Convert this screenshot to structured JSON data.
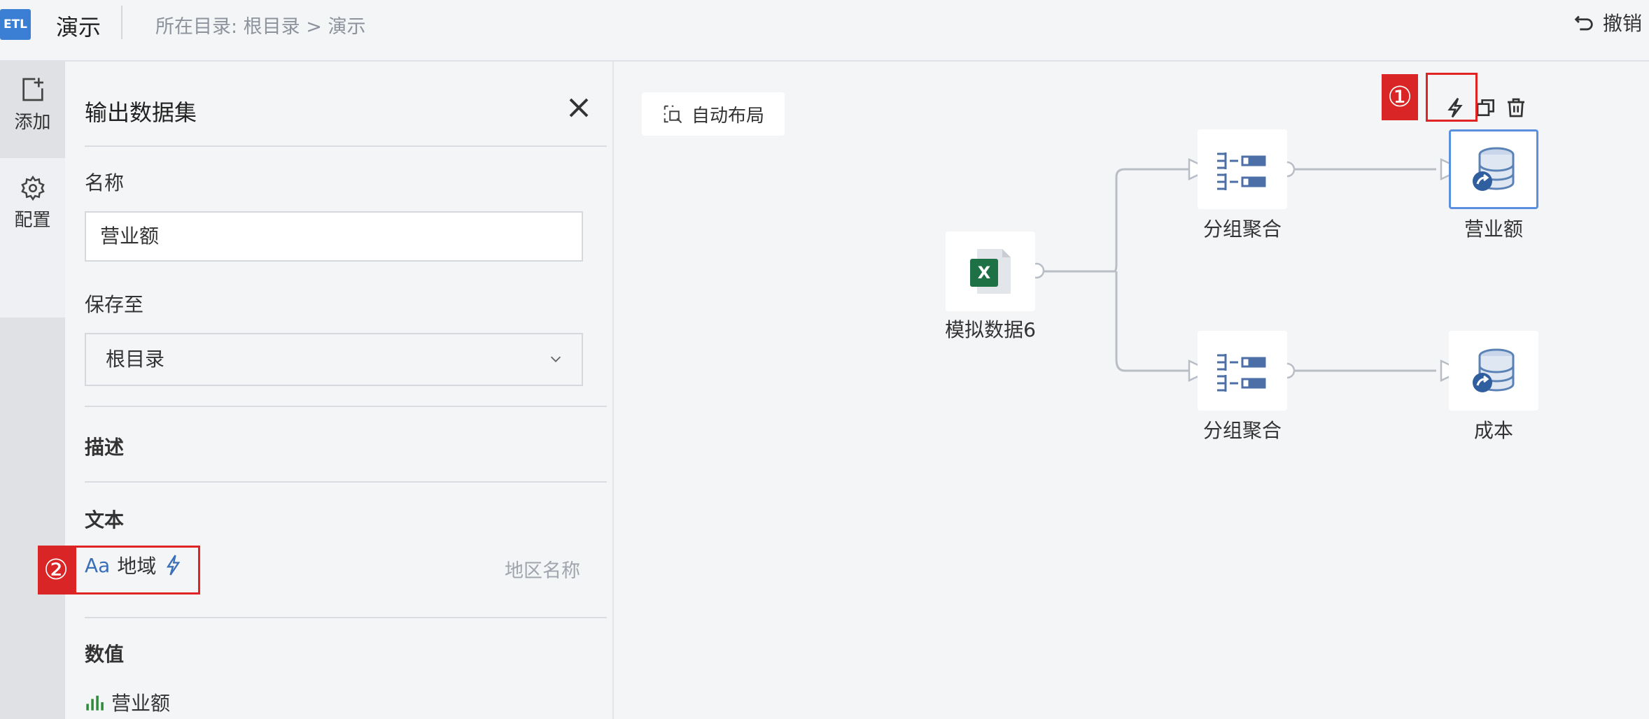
{
  "header": {
    "logo": "ETL",
    "title": "演示",
    "breadcrumb": "所在目录: 根目录 > 演示",
    "undo_label": "撤销"
  },
  "rail": {
    "add_label": "添加",
    "config_label": "配置"
  },
  "panel": {
    "title": "输出数据集",
    "name_label": "名称",
    "name_value": "营业额",
    "save_label": "保存至",
    "save_value": "根目录",
    "desc_label": "描述",
    "text_section": "文本",
    "text_field": {
      "prefix": "Aa",
      "name": "地域",
      "desc": "地区名称"
    },
    "number_section": "数值",
    "number_field": {
      "name": "营业额"
    },
    "marker_2": "②"
  },
  "canvas": {
    "auto_layout_label": "自动布局",
    "marker_1": "①",
    "nodes": {
      "source": "模拟数据6",
      "group1": "分组聚合",
      "group2": "分组聚合",
      "out1": "营业额",
      "out2": "成本"
    }
  },
  "colors": {
    "accent": "#3b7fd4",
    "annotation_red": "#e02424",
    "excel_green": "#1e7145",
    "db_blue": "#5a82b5"
  }
}
